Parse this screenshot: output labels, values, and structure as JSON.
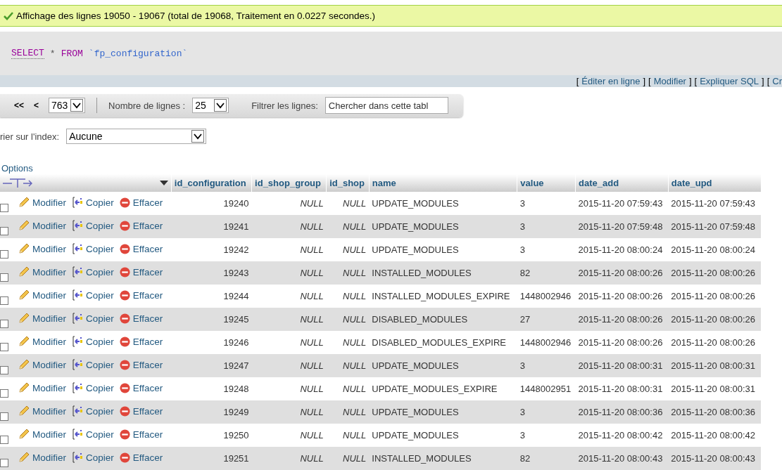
{
  "message": {
    "text": "Affichage des lignes 19050 - 19067 (total de 19068, Traitement en 0.0227 secondes.)"
  },
  "query": {
    "keyword_select": "SELECT",
    "star": "*",
    "keyword_from": "FROM",
    "table": "`fp_configuration`"
  },
  "query_links": [
    {
      "open": "[",
      "label": "Éditer en ligne",
      "close": "]"
    },
    {
      "open": "[",
      "label": "Modifier",
      "close": "]"
    },
    {
      "open": "[",
      "label": "Expliquer SQL",
      "close": "]"
    },
    {
      "open": "[",
      "label": "Cr"
    }
  ],
  "navigation": {
    "first": "<<",
    "previous": "<",
    "page": "763",
    "rows_label": "Nombre de lignes :",
    "rows_value": "25",
    "filter_label": "Filtrer les lignes:",
    "filter_placeholder": "Chercher dans cette tabl"
  },
  "index_sort": {
    "label": "rier sur l'index:",
    "value": "Aucune"
  },
  "options_link": "Options",
  "table": {
    "columns": [
      {
        "label": "id_configuration",
        "kind": "number"
      },
      {
        "label": "id_shop_group",
        "kind": "null"
      },
      {
        "label": "id_shop",
        "kind": "null"
      },
      {
        "label": "name",
        "kind": "text"
      },
      {
        "label": "value",
        "kind": "text"
      },
      {
        "label": "date_add",
        "kind": "text"
      },
      {
        "label": "date_upd",
        "kind": "text"
      }
    ],
    "rows": [
      {
        "checked": false,
        "actions": [
          {
            "kind": "edit",
            "label": "Modifier"
          },
          {
            "kind": "copy",
            "label": "Copier"
          },
          {
            "kind": "delete",
            "label": "Effacer"
          }
        ],
        "cells": [
          "19240",
          "NULL",
          "NULL",
          "UPDATE_MODULES",
          "3",
          "2015-11-20 07:59:43",
          "2015-11-20 07:59:43"
        ]
      },
      {
        "checked": false,
        "actions": [
          {
            "kind": "edit",
            "label": "Modifier"
          },
          {
            "kind": "copy",
            "label": "Copier"
          },
          {
            "kind": "delete",
            "label": "Effacer"
          }
        ],
        "cells": [
          "19241",
          "NULL",
          "NULL",
          "UPDATE_MODULES",
          "3",
          "2015-11-20 07:59:48",
          "2015-11-20 07:59:48"
        ]
      },
      {
        "checked": false,
        "actions": [
          {
            "kind": "edit",
            "label": "Modifier"
          },
          {
            "kind": "copy",
            "label": "Copier"
          },
          {
            "kind": "delete",
            "label": "Effacer"
          }
        ],
        "cells": [
          "19242",
          "NULL",
          "NULL",
          "UPDATE_MODULES",
          "3",
          "2015-11-20 08:00:24",
          "2015-11-20 08:00:24"
        ]
      },
      {
        "checked": false,
        "actions": [
          {
            "kind": "edit",
            "label": "Modifier"
          },
          {
            "kind": "copy",
            "label": "Copier"
          },
          {
            "kind": "delete",
            "label": "Effacer"
          }
        ],
        "cells": [
          "19243",
          "NULL",
          "NULL",
          "INSTALLED_MODULES",
          "82",
          "2015-11-20 08:00:26",
          "2015-11-20 08:00:26"
        ]
      },
      {
        "checked": false,
        "actions": [
          {
            "kind": "edit",
            "label": "Modifier"
          },
          {
            "kind": "copy",
            "label": "Copier"
          },
          {
            "kind": "delete",
            "label": "Effacer"
          }
        ],
        "cells": [
          "19244",
          "NULL",
          "NULL",
          "INSTALLED_MODULES_EXPIRE",
          "1448002946",
          "2015-11-20 08:00:26",
          "2015-11-20 08:00:26"
        ]
      },
      {
        "checked": false,
        "actions": [
          {
            "kind": "edit",
            "label": "Modifier"
          },
          {
            "kind": "copy",
            "label": "Copier"
          },
          {
            "kind": "delete",
            "label": "Effacer"
          }
        ],
        "cells": [
          "19245",
          "NULL",
          "NULL",
          "DISABLED_MODULES",
          "27",
          "2015-11-20 08:00:26",
          "2015-11-20 08:00:26"
        ]
      },
      {
        "checked": false,
        "actions": [
          {
            "kind": "edit",
            "label": "Modifier"
          },
          {
            "kind": "copy",
            "label": "Copier"
          },
          {
            "kind": "delete",
            "label": "Effacer"
          }
        ],
        "cells": [
          "19246",
          "NULL",
          "NULL",
          "DISABLED_MODULES_EXPIRE",
          "1448002946",
          "2015-11-20 08:00:26",
          "2015-11-20 08:00:26"
        ]
      },
      {
        "checked": false,
        "actions": [
          {
            "kind": "edit",
            "label": "Modifier"
          },
          {
            "kind": "copy",
            "label": "Copier"
          },
          {
            "kind": "delete",
            "label": "Effacer"
          }
        ],
        "cells": [
          "19247",
          "NULL",
          "NULL",
          "UPDATE_MODULES",
          "3",
          "2015-11-20 08:00:31",
          "2015-11-20 08:00:31"
        ]
      },
      {
        "checked": false,
        "actions": [
          {
            "kind": "edit",
            "label": "Modifier"
          },
          {
            "kind": "copy",
            "label": "Copier"
          },
          {
            "kind": "delete",
            "label": "Effacer"
          }
        ],
        "cells": [
          "19248",
          "NULL",
          "NULL",
          "UPDATE_MODULES_EXPIRE",
          "1448002951",
          "2015-11-20 08:00:31",
          "2015-11-20 08:00:31"
        ]
      },
      {
        "checked": false,
        "actions": [
          {
            "kind": "edit",
            "label": "Modifier"
          },
          {
            "kind": "copy",
            "label": "Copier"
          },
          {
            "kind": "delete",
            "label": "Effacer"
          }
        ],
        "cells": [
          "19249",
          "NULL",
          "NULL",
          "UPDATE_MODULES",
          "3",
          "2015-11-20 08:00:36",
          "2015-11-20 08:00:36"
        ]
      },
      {
        "checked": false,
        "actions": [
          {
            "kind": "edit",
            "label": "Modifier"
          },
          {
            "kind": "copy",
            "label": "Copier"
          },
          {
            "kind": "delete",
            "label": "Effacer"
          }
        ],
        "cells": [
          "19250",
          "NULL",
          "NULL",
          "UPDATE_MODULES",
          "3",
          "2015-11-20 08:00:42",
          "2015-11-20 08:00:42"
        ]
      },
      {
        "checked": false,
        "actions": [
          {
            "kind": "edit",
            "label": "Modifier"
          },
          {
            "kind": "copy",
            "label": "Copier"
          },
          {
            "kind": "delete",
            "label": "Effacer"
          }
        ],
        "cells": [
          "19251",
          "NULL",
          "NULL",
          "INSTALLED_MODULES",
          "82",
          "2015-11-20 08:00:43",
          "2015-11-20 08:00:43"
        ]
      }
    ]
  }
}
